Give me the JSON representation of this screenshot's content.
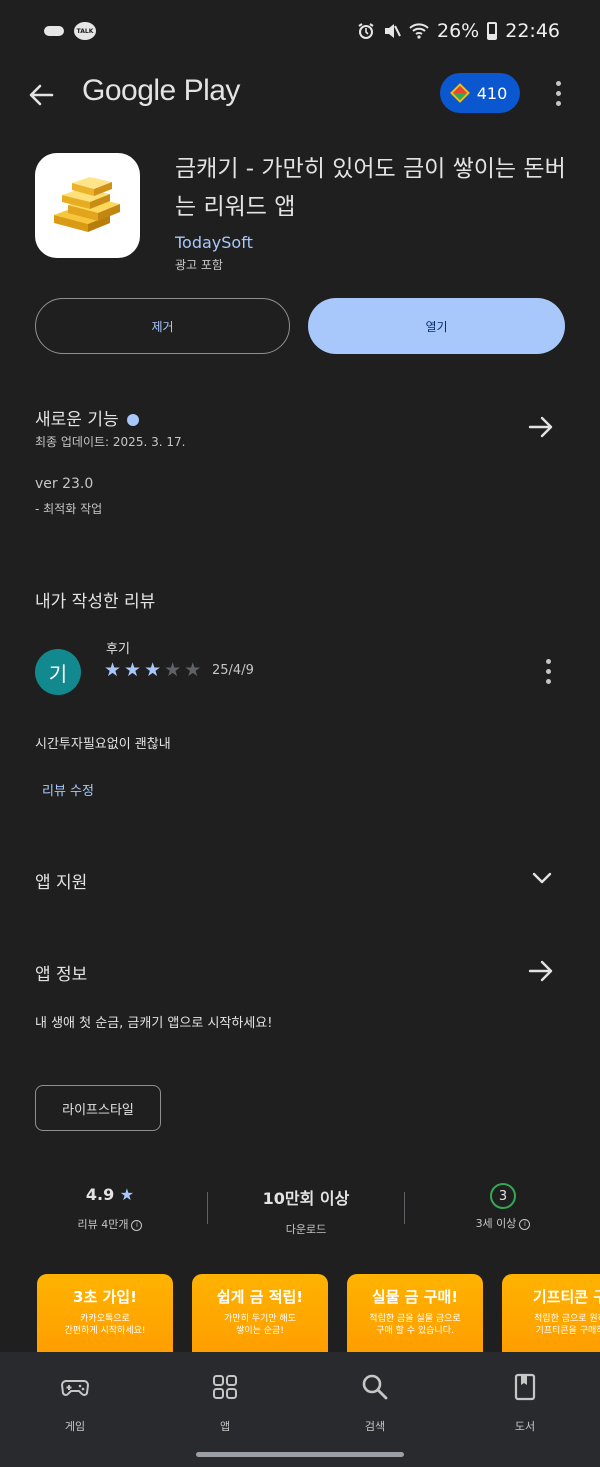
{
  "status_bar": {
    "talk_label": "TALK",
    "battery": "26%",
    "time": "22:46"
  },
  "header": {
    "title": "Google Play",
    "points": "410"
  },
  "app": {
    "name": "금캐기 - 가만히 있어도 금이 쌓이는 돈버는 리워드 앱",
    "developer": "TodaySoft",
    "ads": "광고 포함",
    "remove_label": "제거",
    "open_label": "열기"
  },
  "whats_new": {
    "title": "새로운 기능",
    "updated": "최종 업데이트: 2025. 3. 17.",
    "version": "ver 23.0",
    "note": "- 최적화 작업"
  },
  "my_review": {
    "title": "내가 작성한 리뷰",
    "avatar_letter": "기",
    "name": "후기",
    "stars": 3,
    "max_stars": 5,
    "date": "25/4/9",
    "text": "시간투자필요없이 괜찮내",
    "edit_label": "리뷰 수정"
  },
  "support": {
    "title": "앱 지원"
  },
  "about": {
    "title": "앱 정보",
    "tagline": "내 생애 첫 순금, 금캐기 앱으로 시작하세요!",
    "category": "라이프스타일"
  },
  "stats": {
    "rating": "4.9",
    "reviews_label": "리뷰 4만개",
    "downloads": "10만회 이상",
    "downloads_label": "다운로드",
    "age": "3",
    "age_label": "3세 이상"
  },
  "screenshots": [
    {
      "title": "3초 가입!",
      "desc": "카카오톡으로\n간편하게 시작하세요!"
    },
    {
      "title": "쉽게 금 적립!",
      "desc": "가만히 두기만 해도\n쌓이는 순금!"
    },
    {
      "title": "실물 금 구매!",
      "desc": "적립한 금을 실물 금으로\n구매 할 수 있습니다."
    },
    {
      "title": "기프티콘 구",
      "desc": "적립한 금으로 원하\n기프티콘을 구매하"
    }
  ],
  "nav": [
    {
      "label": "게임",
      "icon": "gamepad-icon"
    },
    {
      "label": "앱",
      "icon": "apps-grid-icon"
    },
    {
      "label": "검색",
      "icon": "search-icon"
    },
    {
      "label": "도서",
      "icon": "book-icon"
    }
  ],
  "colors": {
    "background": "#1f1f1f",
    "accent": "#a8c7fa",
    "points_badge": "#0b57d0",
    "avatar": "#12888f",
    "age_ring": "#34a853"
  }
}
